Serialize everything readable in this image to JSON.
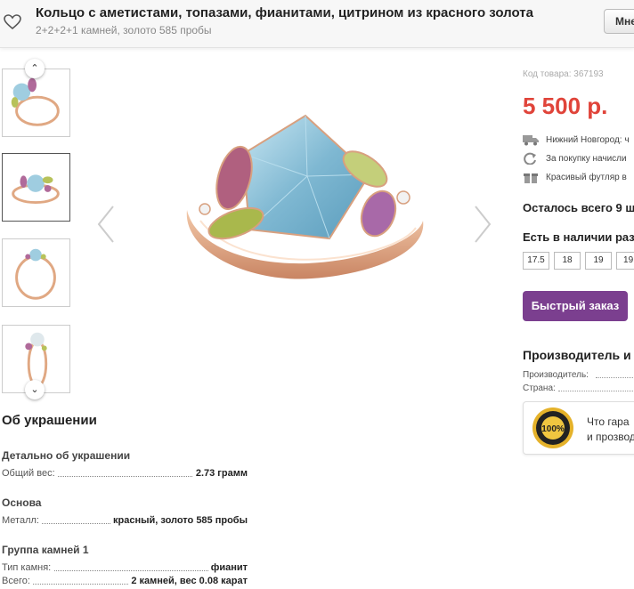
{
  "header": {
    "title": "Кольцо с аметистами, топазами, фианитами, цитрином из красного золота",
    "subtitle": "2+2+2+1 камней, золото 585 пробы",
    "button_label": "Мне"
  },
  "product": {
    "code": "Код товара: 367193",
    "price": "5 500 р.",
    "features": [
      {
        "icon": "truck-icon",
        "text": "Нижний Новгород: ч"
      },
      {
        "icon": "refresh-icon",
        "text": "За покупку начисли"
      },
      {
        "icon": "gift-icon",
        "text": "Красивый футляр в"
      }
    ],
    "remaining": "Осталось всего 9 ш",
    "availability_title": "Есть в наличии раз",
    "sizes": [
      "17.5",
      "18",
      "19",
      "19."
    ],
    "buy_button": "Быстрый заказ",
    "maker": {
      "title": "Производитель и",
      "rows": [
        "Производитель:",
        "Страна:"
      ]
    },
    "guarantee": {
      "line1": "Что гара",
      "line2": "и прозвод",
      "seal_text": "100%"
    }
  },
  "about": {
    "title": "Об украшении",
    "groups": [
      {
        "title": "Детально об украшении",
        "rows": [
          {
            "label": "Общий вес:",
            "value": "2.73 грамм"
          }
        ]
      },
      {
        "title": "Основа",
        "rows": [
          {
            "label": "Металл:",
            "value": "красный, золото 585 пробы"
          }
        ]
      },
      {
        "title": "Группа камней 1",
        "rows": [
          {
            "label": "Тип камня:",
            "value": "фианит"
          },
          {
            "label": "Всего:",
            "value": "2 камней, вес 0.08 карат"
          }
        ]
      }
    ]
  },
  "colors": {
    "price": "#e0443a",
    "button": "#7b3f8f",
    "stone_blue": "#8fc3d8",
    "stone_purple": "#b06a9a",
    "stone_green": "#b7c25a",
    "gold": "#e3a987"
  }
}
